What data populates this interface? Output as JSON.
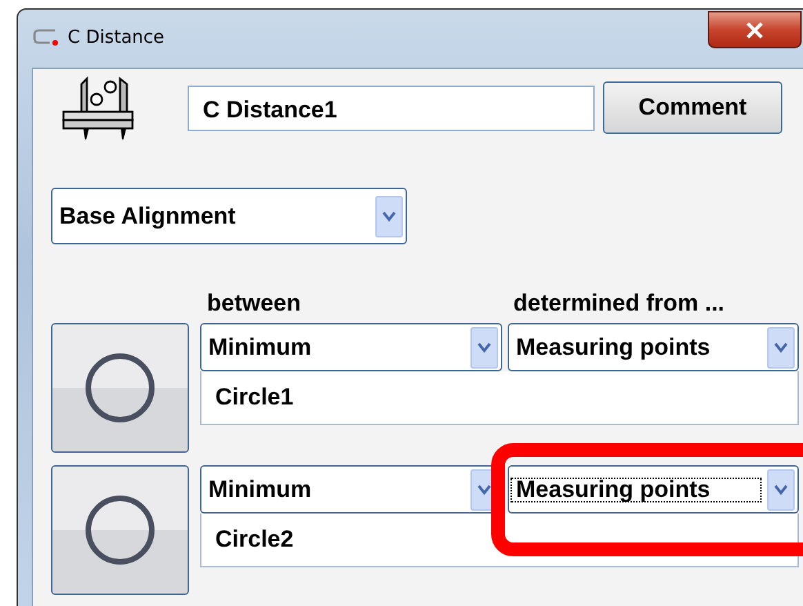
{
  "window": {
    "title": "C Distance"
  },
  "name_field": {
    "value": "C Distance1"
  },
  "comment_button": {
    "label": "Comment"
  },
  "alignment": {
    "value": "Base Alignment"
  },
  "column_headers": [
    "between",
    "determined from ..."
  ],
  "elements": [
    {
      "kind": "circle",
      "mode": "Minimum",
      "source": "Measuring points",
      "source_focused": false,
      "highlighted": false,
      "name": "Circle1"
    },
    {
      "kind": "circle",
      "mode": "Minimum",
      "source": "Measuring points",
      "source_focused": true,
      "highlighted": true,
      "name": "Circle2"
    }
  ]
}
